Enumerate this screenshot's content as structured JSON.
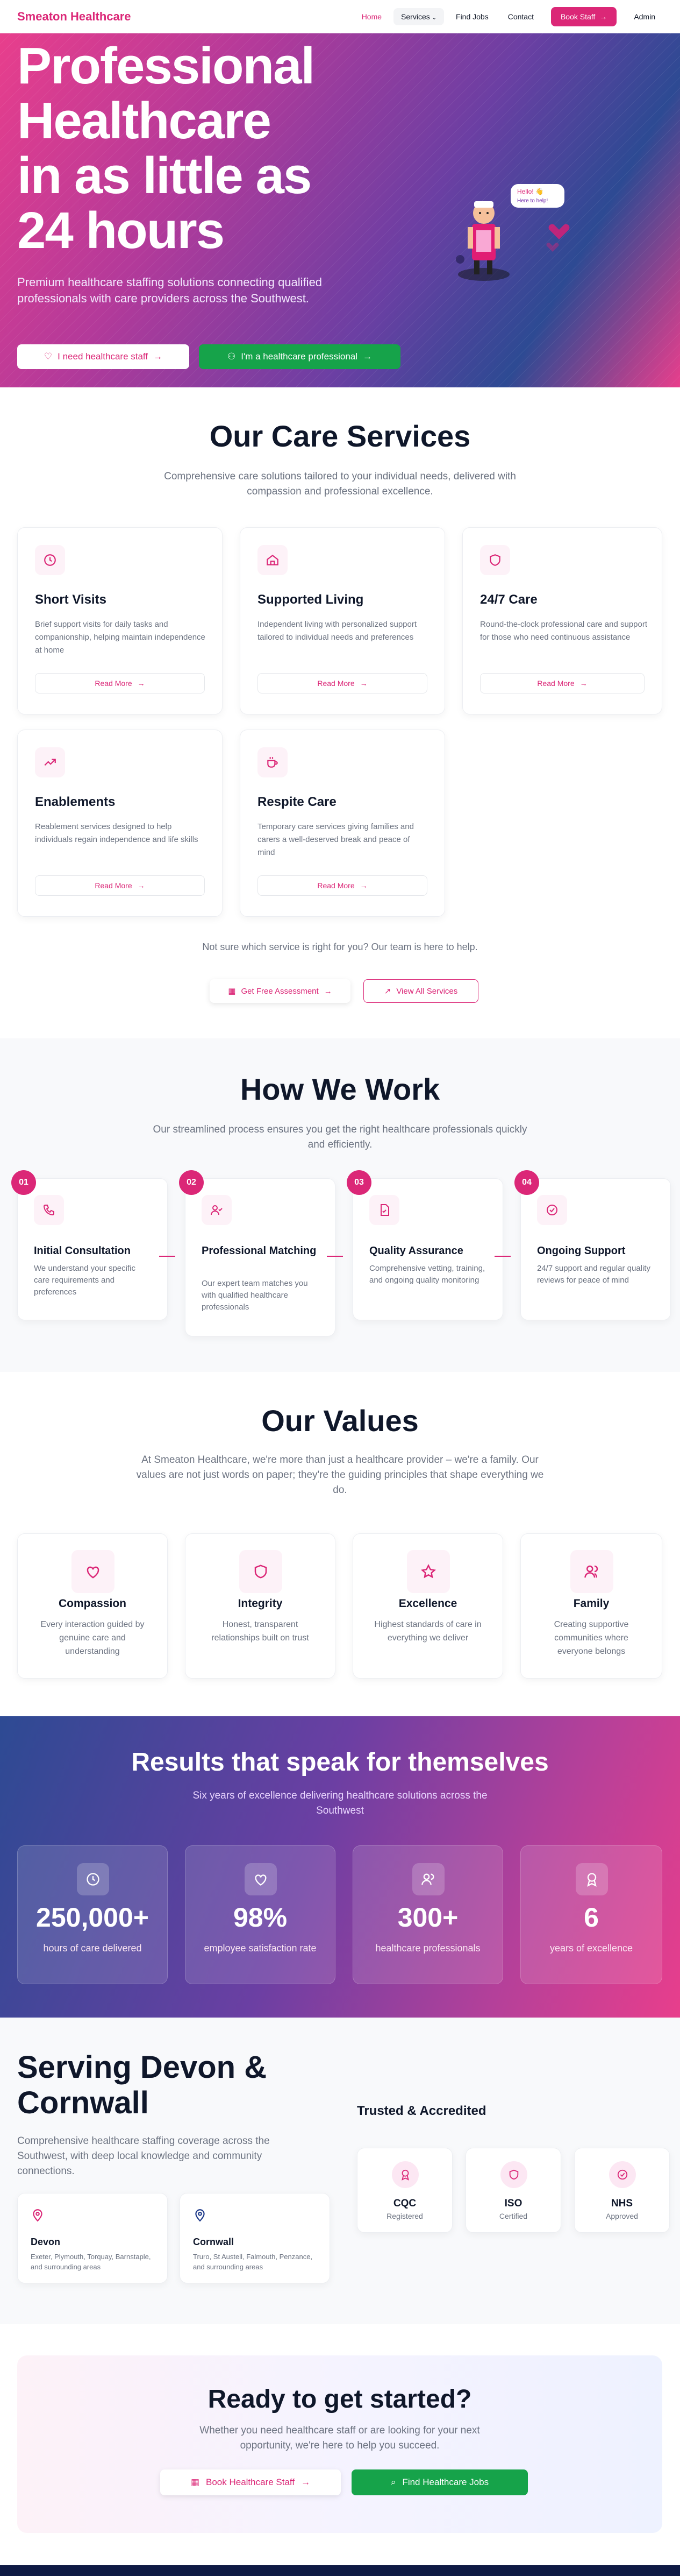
{
  "nav": {
    "brand": "Smeaton Healthcare",
    "links": [
      "Home",
      "Services",
      "Find Jobs",
      "Contact"
    ],
    "cta": "Book Staff",
    "admin": "Admin"
  },
  "hero": {
    "title_lines": [
      "Professional",
      "Healthcare",
      "in as little as",
      "24 hours"
    ],
    "subtitle": "Premium healthcare staffing solutions connecting qualified professionals with care providers across the Southwest.",
    "btn1": "I need healthcare staff",
    "btn2": "I'm a healthcare professional",
    "bubble1": "Hello! 👋",
    "bubble2": "Here to help!"
  },
  "services": {
    "title": "Our Care Services",
    "subtitle": "Comprehensive care solutions tailored to your individual needs, delivered with compassion and professional excellence.",
    "read_more": "Read More",
    "cards": [
      {
        "title": "Short Visits",
        "desc": "Brief support visits for daily tasks and companionship, helping maintain independence at home",
        "icon": "clock-icon"
      },
      {
        "title": "Supported Living",
        "desc": "Independent living with personalized support tailored to individual needs and preferences",
        "icon": "home-icon"
      },
      {
        "title": "24/7 Care",
        "desc": "Round-the-clock professional care and support for those who need continuous assistance",
        "icon": "shield-icon"
      },
      {
        "title": "Enablements",
        "desc": "Reablement services designed to help individuals regain independence and life skills",
        "icon": "trending-up-icon"
      },
      {
        "title": "Respite Care",
        "desc": "Temporary care services giving families and carers a well-deserved break and peace of mind",
        "icon": "coffee-icon"
      }
    ],
    "note": "Not sure which service is right for you? Our team is here to help.",
    "btn_assess": "Get Free Assessment",
    "btn_all": "View All Services"
  },
  "how": {
    "title": "How We Work",
    "subtitle": "Our streamlined process ensures you get the right healthcare professionals quickly and efficiently.",
    "steps": [
      {
        "num": "01",
        "title": "Initial Consultation",
        "desc": "We understand your specific care requirements and preferences"
      },
      {
        "num": "02",
        "title": "Professional Matching",
        "desc": "Our expert team matches you with qualified healthcare professionals"
      },
      {
        "num": "03",
        "title": "Quality Assurance",
        "desc": "Comprehensive vetting, training, and ongoing quality monitoring"
      },
      {
        "num": "04",
        "title": "Ongoing Support",
        "desc": "24/7 support and regular quality reviews for peace of mind"
      }
    ]
  },
  "values": {
    "title": "Our Values",
    "subtitle": "At Smeaton Healthcare, we're more than just a healthcare provider – we're a family. Our values are not just words on paper; they're the guiding principles that shape everything we do.",
    "items": [
      {
        "title": "Compassion",
        "desc": "Every interaction guided by genuine care and understanding"
      },
      {
        "title": "Integrity",
        "desc": "Honest, transparent relationships built on trust"
      },
      {
        "title": "Excellence",
        "desc": "Highest standards of care in everything we deliver"
      },
      {
        "title": "Family",
        "desc": "Creating supportive communities where everyone belongs"
      }
    ]
  },
  "results": {
    "title": "Results that speak for themselves",
    "subtitle": "Six years of excellence delivering healthcare solutions across the Southwest",
    "stats": [
      {
        "value": "250,000+",
        "label": "hours of care delivered"
      },
      {
        "value": "98%",
        "label": "employee satisfaction rate"
      },
      {
        "value": "300+",
        "label": "healthcare professionals"
      },
      {
        "value": "6",
        "label": "years of excellence"
      }
    ]
  },
  "serving": {
    "title": "Serving Devon & Cornwall",
    "desc": "Comprehensive healthcare staffing coverage across the Southwest, with deep local knowledge and community connections.",
    "regions": [
      {
        "name": "Devon",
        "areas": "Exeter, Plymouth, Torquay, Barnstaple, and surrounding areas"
      },
      {
        "name": "Cornwall",
        "areas": "Truro, St Austell, Falmouth, Penzance, and surrounding areas"
      }
    ],
    "trusted": "Trusted & Accredited",
    "accreds": [
      {
        "t": "CQC",
        "s": "Registered"
      },
      {
        "t": "ISO",
        "s": "Certified"
      },
      {
        "t": "NHS",
        "s": "Approved"
      }
    ]
  },
  "cta": {
    "title": "Ready to get started?",
    "subtitle": "Whether you need healthcare staff or are looking for your next opportunity, we're here to help you succeed.",
    "btn1": "Book Healthcare Staff",
    "btn2": "Find Healthcare Jobs"
  }
}
